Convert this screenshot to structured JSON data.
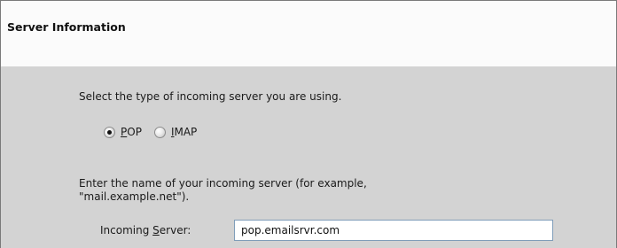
{
  "header": {
    "title": "Server Information"
  },
  "server_type": {
    "prompt": "Select the type of incoming server you are using.",
    "options": [
      {
        "label_accel": "P",
        "label_rest": "OP",
        "selected": true
      },
      {
        "label_accel": "I",
        "label_rest": "MAP",
        "selected": false
      }
    ]
  },
  "server_name": {
    "prompt_line1": "Enter the name of your incoming server (for example,",
    "prompt_line2": "\"mail.example.net\").",
    "label_before": "Incoming ",
    "label_accel": "S",
    "label_after": "erver:",
    "value": "pop.emailsrvr.com"
  }
}
